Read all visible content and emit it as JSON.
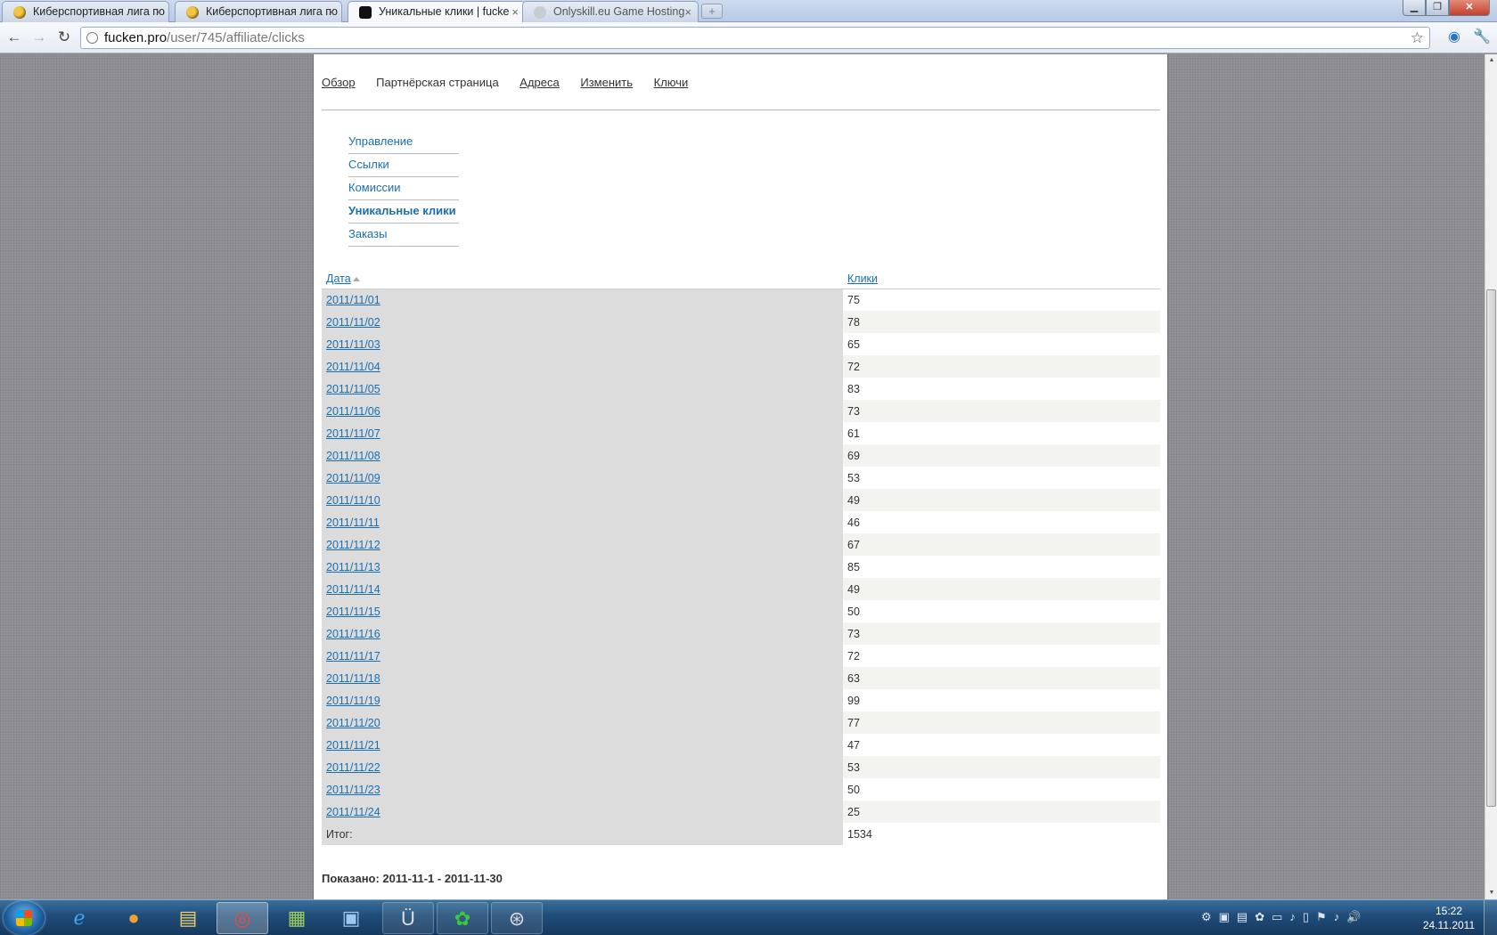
{
  "browser": {
    "tabs": [
      {
        "title": "Киберспортивная лига по",
        "icon": "bee-favicon"
      },
      {
        "title": "Киберспортивная лига по",
        "icon": "bee-favicon"
      },
      {
        "title": "Уникальные клики | fucke",
        "icon": "wolf-favicon"
      },
      {
        "title": "Onlyskill.eu Game Hosting",
        "icon": "globe-favicon"
      }
    ],
    "url_host": "fucken.pro",
    "url_path": "/user/745/affiliate/clicks"
  },
  "page": {
    "primary_tabs": [
      "Обзор",
      "Партнёрская страница",
      "Адреса",
      "Изменить",
      "Ключи"
    ],
    "secondary_menu": [
      "Управление",
      "Ссылки",
      "Комиссии",
      "Уникальные клики",
      "Заказы"
    ],
    "table": {
      "col_date": "Дата",
      "col_clicks": "Клики",
      "rows": [
        {
          "date": "2011/11/01",
          "clicks": "75"
        },
        {
          "date": "2011/11/02",
          "clicks": "78"
        },
        {
          "date": "2011/11/03",
          "clicks": "65"
        },
        {
          "date": "2011/11/04",
          "clicks": "72"
        },
        {
          "date": "2011/11/05",
          "clicks": "83"
        },
        {
          "date": "2011/11/06",
          "clicks": "73"
        },
        {
          "date": "2011/11/07",
          "clicks": "61"
        },
        {
          "date": "2011/11/08",
          "clicks": "69"
        },
        {
          "date": "2011/11/09",
          "clicks": "53"
        },
        {
          "date": "2011/11/10",
          "clicks": "49"
        },
        {
          "date": "2011/11/11",
          "clicks": "46"
        },
        {
          "date": "2011/11/12",
          "clicks": "67"
        },
        {
          "date": "2011/11/13",
          "clicks": "85"
        },
        {
          "date": "2011/11/14",
          "clicks": "49"
        },
        {
          "date": "2011/11/15",
          "clicks": "50"
        },
        {
          "date": "2011/11/16",
          "clicks": "73"
        },
        {
          "date": "2011/11/17",
          "clicks": "72"
        },
        {
          "date": "2011/11/18",
          "clicks": "63"
        },
        {
          "date": "2011/11/19",
          "clicks": "99"
        },
        {
          "date": "2011/11/20",
          "clicks": "77"
        },
        {
          "date": "2011/11/21",
          "clicks": "47"
        },
        {
          "date": "2011/11/22",
          "clicks": "53"
        },
        {
          "date": "2011/11/23",
          "clicks": "50"
        },
        {
          "date": "2011/11/24",
          "clicks": "25"
        }
      ],
      "total_label": "Итог:",
      "total_value": "1534"
    },
    "shown_range": "Показано: 2011-11-1 - 2011-11-30"
  },
  "taskbar": {
    "time": "15:22",
    "date": "24.11.2011"
  },
  "colors": {
    "link": "#1a6fb2",
    "date_cell_bg": "#dcdcdc",
    "page_bg": "#8e8e92"
  }
}
